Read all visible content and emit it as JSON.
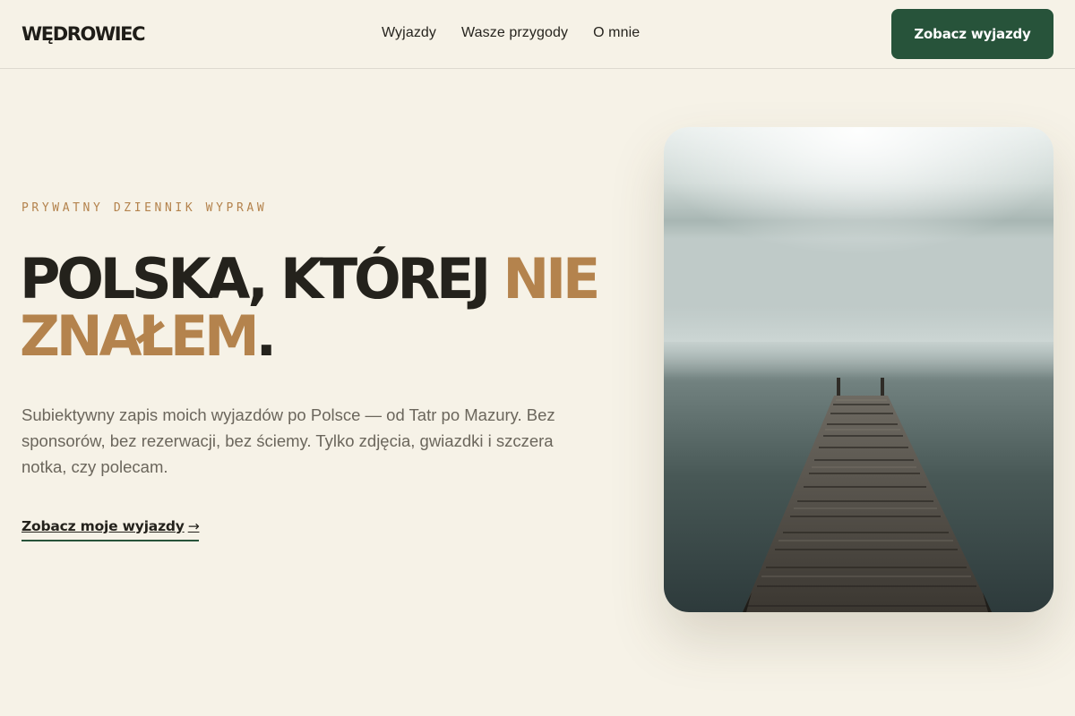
{
  "header": {
    "logo": "WĘDROWIEC",
    "nav": [
      "Wyjazdy",
      "Wasze przygody",
      "O mnie"
    ],
    "cta_label": "Zobacz wyjazdy"
  },
  "hero": {
    "eyebrow": "PRYWATNY DZIENNIK WYPRAW",
    "headline_part1": "POLSKA, KTÓREJ ",
    "headline_accent": "NIE ZNAŁEM",
    "headline_end": ".",
    "lead": "Subiektywny zapis moich wyjazdów po Polsce — od Tatr po Mazury. Bez sponsorów, bez rezerwacji, bez ściemy. Tylko zdjęcia, gwiazdki i szczera notka, czy polecam.",
    "link_label": "Zobacz moje wyjazdy",
    "link_arrow": "→",
    "image_subject": "misty lake with wooden pier"
  },
  "colors": {
    "background": "#f6f2e7",
    "accent": "#b4834d",
    "brand_green": "#27533a",
    "text_dark": "#24221c",
    "text_muted": "#6b665c"
  }
}
